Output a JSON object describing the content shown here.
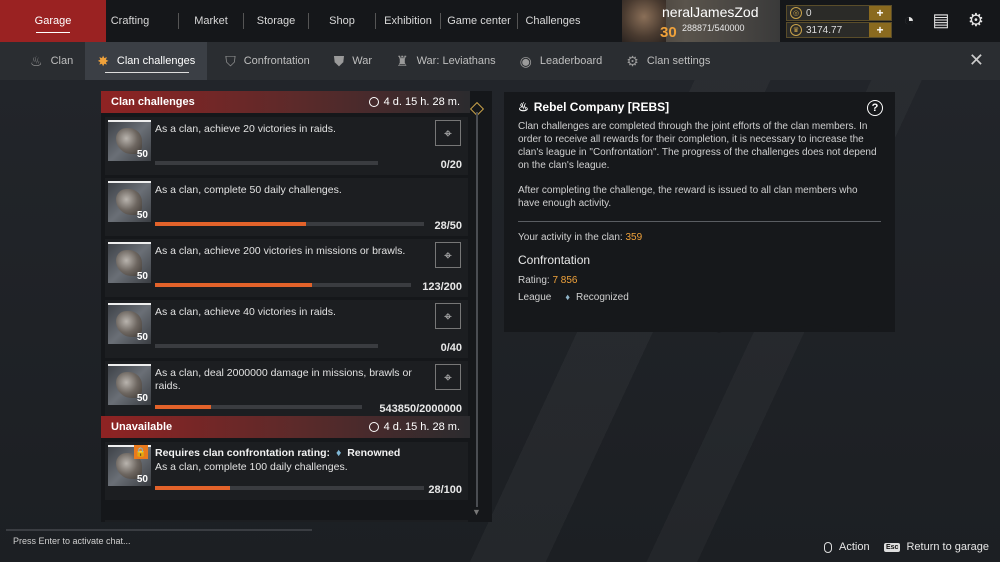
{
  "topnav": {
    "tabs": [
      {
        "label": "Garage",
        "active": true
      },
      {
        "label": "Crafting"
      },
      {
        "label": "Market"
      },
      {
        "label": "Storage"
      },
      {
        "label": "Shop"
      },
      {
        "label": "Exhibition"
      },
      {
        "label": "Game center"
      },
      {
        "label": "Challenges"
      }
    ]
  },
  "player": {
    "name": "neralJamesZod",
    "level": "30",
    "exp": "288871/540000"
  },
  "currency": {
    "coins": "0",
    "crowns": "3174.77"
  },
  "subnav": {
    "tabs": [
      {
        "label": "Clan",
        "icon": "flame-icon"
      },
      {
        "label": "Clan challenges",
        "icon": "challenge-badge-icon",
        "active": true
      },
      {
        "label": "Confrontation",
        "icon": "shield-icon"
      },
      {
        "label": "War",
        "icon": "war-shield-icon"
      },
      {
        "label": "War: Leviathans",
        "icon": "leviathan-icon"
      },
      {
        "label": "Leaderboard",
        "icon": "leaderboard-icon"
      },
      {
        "label": "Clan settings",
        "icon": "gear-icon"
      }
    ]
  },
  "challenges": {
    "active_header": "Clan challenges",
    "active_timer": "4 d. 15 h. 28 m.",
    "items": [
      {
        "level": "50",
        "text": "As a clan, achieve 20 victories in raids.",
        "progress_text": "0/20",
        "progress": 0
      },
      {
        "level": "50",
        "text": "As a clan, complete 50 daily challenges.",
        "progress_text": "28/50",
        "progress": 0.56
      },
      {
        "level": "50",
        "text": "As a clan, achieve 200 victories in missions or brawls.",
        "progress_text": "123/200",
        "progress": 0.615
      },
      {
        "level": "50",
        "text": "As a clan, achieve 40 victories in raids.",
        "progress_text": "0/40",
        "progress": 0
      },
      {
        "level": "50",
        "text": "As a clan, deal 2000000 damage in missions, brawls or raids.",
        "progress_text": "543850/2000000",
        "progress": 0.272
      }
    ],
    "unavailable_header": "Unavailable",
    "unavailable_timer": "4 d. 15 h. 28 m.",
    "locked_item": {
      "level": "50",
      "requirement": "Requires clan confrontation rating:",
      "rank": "Renowned",
      "text": "As a clan, complete 100 daily challenges.",
      "progress_text": "28/100",
      "progress": 0.28
    }
  },
  "info": {
    "title": "Rebel Company [REBS]",
    "p1": "Clan challenges are completed through the joint efforts of the clan members. In order to receive all rewards for their completion, it is necessary to increase the clan's league in \"Confrontation\". The progress of the challenges does not depend on the clan's league.",
    "p2": "After completing the challenge, the reward is issued to all clan members who have enough activity.",
    "activity_label": "Your activity in the clan:",
    "activity_value": "359",
    "confrontation_heading": "Confrontation",
    "rating_label": "Rating:",
    "rating_value": "7 856",
    "league_label": "League",
    "league_value": "Recognized"
  },
  "footer": {
    "chat_hint": "Press Enter to activate chat...",
    "action_label": "Action",
    "esc_key": "Esc",
    "return_label": "Return to garage"
  }
}
